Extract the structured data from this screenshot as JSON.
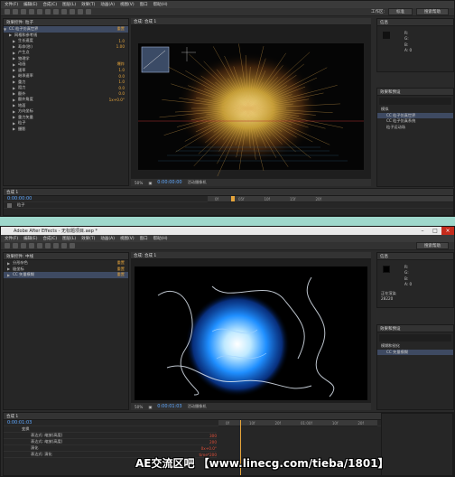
{
  "top": {
    "menu": [
      "文件(F)",
      "编辑(E)",
      "合成(C)",
      "图层(L)",
      "效果(T)",
      "动画(A)",
      "视图(V)",
      "窗口",
      "帮助(H)"
    ],
    "workspace_label": "工作区:",
    "workspace_value": "标准",
    "search_label": "搜索帮助",
    "effects_tab": "效果控件: 粒子",
    "comp_tab": "合成: 合成 1",
    "effect_name": "CC 粒子仿真世界",
    "properties": [
      {
        "name": "网格和参考线",
        "value": ""
      },
      {
        "name": "生长速度",
        "value": "1.0"
      },
      {
        "name": "寿命(秒)",
        "value": "1.00"
      },
      {
        "name": "产生点",
        "value": ""
      },
      {
        "name": "物理学",
        "value": ""
      },
      {
        "name": "动画",
        "value": "爆炸"
      },
      {
        "name": "速率",
        "value": "1.0"
      },
      {
        "name": "继承速率",
        "value": "0.0"
      },
      {
        "name": "重力",
        "value": "1.0"
      },
      {
        "name": "阻力",
        "value": "0.0"
      },
      {
        "name": "额外",
        "value": "0.0"
      },
      {
        "name": "额外角度",
        "value": "1x+0.0°"
      },
      {
        "name": "地面",
        "value": ""
      },
      {
        "name": "方向坐标",
        "value": ""
      },
      {
        "name": "重力矢量",
        "value": ""
      },
      {
        "name": "粒子",
        "value": ""
      },
      {
        "name": "摄影",
        "value": ""
      }
    ],
    "viewer_zoom": "50%",
    "viewer_time": "0:00:00:00",
    "viewer_mode": "活动摄像机",
    "timeline_tab": "合成 1",
    "timeline_time": "0:00:00:00",
    "layer_name": "粒子",
    "info_values": [
      "R:",
      "G:",
      "B:",
      "A: 0"
    ],
    "effects_panel": "效果和预设",
    "effects_items": [
      "模拟",
      "CC 粒子仿真世界",
      "CC 粒子仿真系统",
      "粒子运动场"
    ],
    "ruler_marks": [
      "0f",
      "05f",
      "10f",
      "15f",
      "20f"
    ]
  },
  "bottom": {
    "app_title": "Adobe After Effects - 无标题项目.aep *",
    "menu": [
      "文件(F)",
      "编辑(E)",
      "合成(C)",
      "图层(L)",
      "效果(T)",
      "动画(A)",
      "视图(V)",
      "窗口",
      "帮助(H)"
    ],
    "search_label": "搜索帮助",
    "effects_tab": "效果控件: 中线",
    "comp_tab": "合成: 合成 1",
    "effect_rows": [
      {
        "name": "分形杂色",
        "value": "重置"
      },
      {
        "name": "极坐标",
        "value": "重置"
      },
      {
        "name": "CC 矢量模糊",
        "value": "重置"
      }
    ],
    "viewer_zoom": "50%",
    "viewer_time": "0:00:01:03",
    "viewer_mode": "活动摄像机",
    "timeline_time": "0:00:01:03",
    "timeline_rows": [
      {
        "name": "变换",
        "value": ""
      },
      {
        "name": "表达式: 缩放(高度)",
        "value": "300"
      },
      {
        "name": "表达式: 缩放(高度)",
        "value": "200"
      },
      {
        "name": "演化",
        "value": "0x+0.0°"
      },
      {
        "name": "表达式: 演化",
        "value": "time*200"
      }
    ],
    "info_values": [
      "R:",
      "G:",
      "B:",
      "A: 0"
    ],
    "render_label": "正在渲染",
    "frame_label": "28220",
    "effects_items": [
      "模糊和锐化",
      "CC 矢量模糊"
    ],
    "ruler_marks": [
      "0f",
      "10f",
      "20f",
      "01:00f",
      "10f",
      "20f"
    ]
  },
  "watermark": "AE交流区吧 【www.linecg.com/tieba/1801】"
}
